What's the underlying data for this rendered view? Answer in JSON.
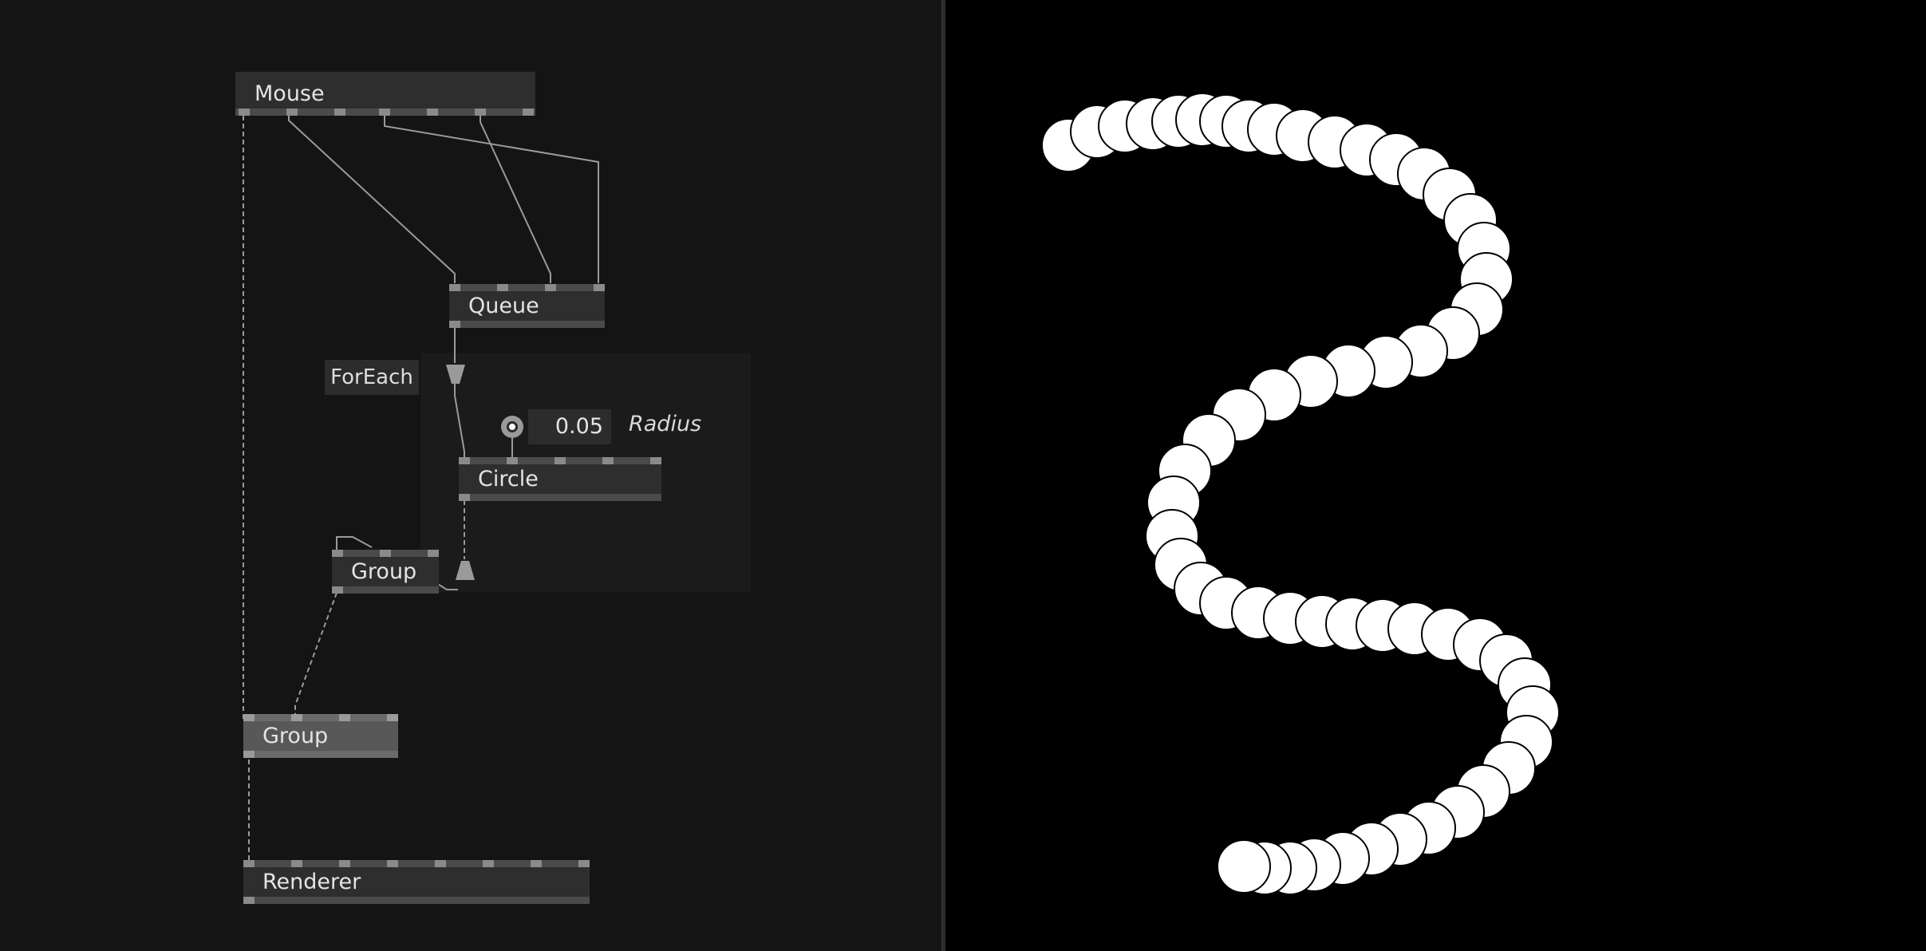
{
  "patch": {
    "nodes": {
      "mouse": "Mouse",
      "queue": "Queue",
      "circle": "Circle",
      "group_inner": "Group",
      "group_outer": "Group",
      "renderer": "Renderer"
    },
    "region": {
      "label": "ForEach"
    },
    "radius_input": {
      "value": "0.05",
      "label": "Radius"
    }
  },
  "colors": {
    "editor_background": "#141414",
    "region_background": "#1b1b1b",
    "node_background": "#2e2e2e",
    "wire": "#9a9a9a",
    "render_background": "#000000",
    "stroke": "#ffffff"
  },
  "icons": {
    "toggle": "bang-toggle-icon",
    "splicer_in": "input-splicer-icon",
    "splicer_out": "output-splicer-icon"
  }
}
